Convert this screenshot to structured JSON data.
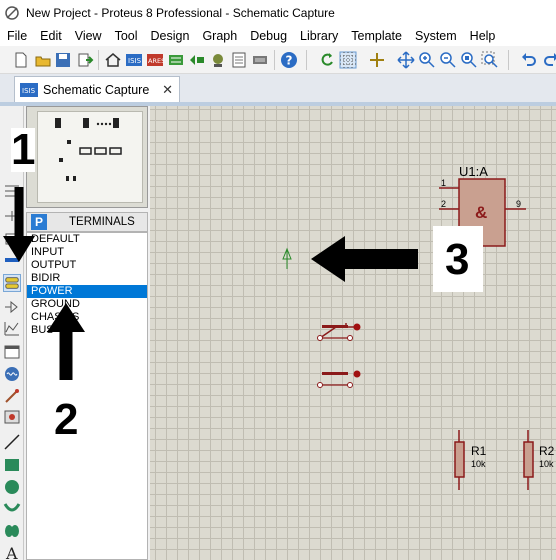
{
  "window": {
    "title": "New Project - Proteus 8 Professional - Schematic Capture"
  },
  "menu": [
    "File",
    "Edit",
    "View",
    "Tool",
    "Design",
    "Graph",
    "Debug",
    "Library",
    "Template",
    "System",
    "Help"
  ],
  "tab": {
    "label": "Schematic Capture",
    "close": "✕"
  },
  "panel": {
    "header": "TERMINALS",
    "button": "P"
  },
  "terminals": [
    "DEFAULT",
    "INPUT",
    "OUTPUT",
    "BIDIR",
    "POWER",
    "GROUND",
    "CHASSIS",
    "BUS"
  ],
  "selected_terminal": "POWER",
  "schematic": {
    "gate": {
      "ref": "U1:A",
      "symbol": "&",
      "pins": [
        "1",
        "2",
        "9"
      ]
    },
    "resistors": [
      {
        "ref": "R1",
        "value": "10k"
      },
      {
        "ref": "R2",
        "value": "10k"
      }
    ]
  },
  "annotations": [
    "1",
    "2",
    "3"
  ],
  "colors": {
    "canvas": "#dcdad0",
    "component": "#8b1a1a",
    "selection": "#0078d7"
  }
}
